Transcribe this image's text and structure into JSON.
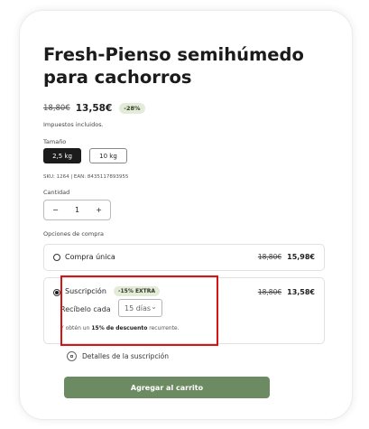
{
  "product": {
    "title": "Fresh-Pienso semihúmedo para cachorros",
    "old_price": "18,80€",
    "new_price": "13,58€",
    "discount_badge": "-28%",
    "tax_note": "Impuestos incluidos."
  },
  "size": {
    "label": "Tamaño",
    "options": [
      "2,5 kg",
      "10 kg"
    ],
    "selected": "2,5 kg"
  },
  "sku": "SKU: 1264 | EAN: 8435117893955",
  "quantity": {
    "label": "Cantidad",
    "minus": "−",
    "value": "1",
    "plus": "+"
  },
  "purchase_options": {
    "label": "Opciones de compra",
    "one_time": {
      "label": "Compra única",
      "old_price": "18,80€",
      "price": "15,98€"
    },
    "subscription": {
      "label": "Suscripción",
      "badge": "-15% EXTRA",
      "old_price": "18,80€",
      "price": "13,58€",
      "receive_label": "Recíbelo cada",
      "frequency": "15 días",
      "discount_prefix": "Y obtén un",
      "discount_strong": "15% de descuento",
      "discount_suffix": "recurrente."
    }
  },
  "details_link": "Detalles de la suscripción",
  "add_to_cart": "Agregar al carrito",
  "colors": {
    "accent_green": "#6d8b63",
    "badge_bg": "#e4ecd9",
    "highlight_red": "#d71414"
  },
  "icons": {
    "details": "subscription-info-icon",
    "frequency_dropdown": "chevron-down-icon"
  }
}
